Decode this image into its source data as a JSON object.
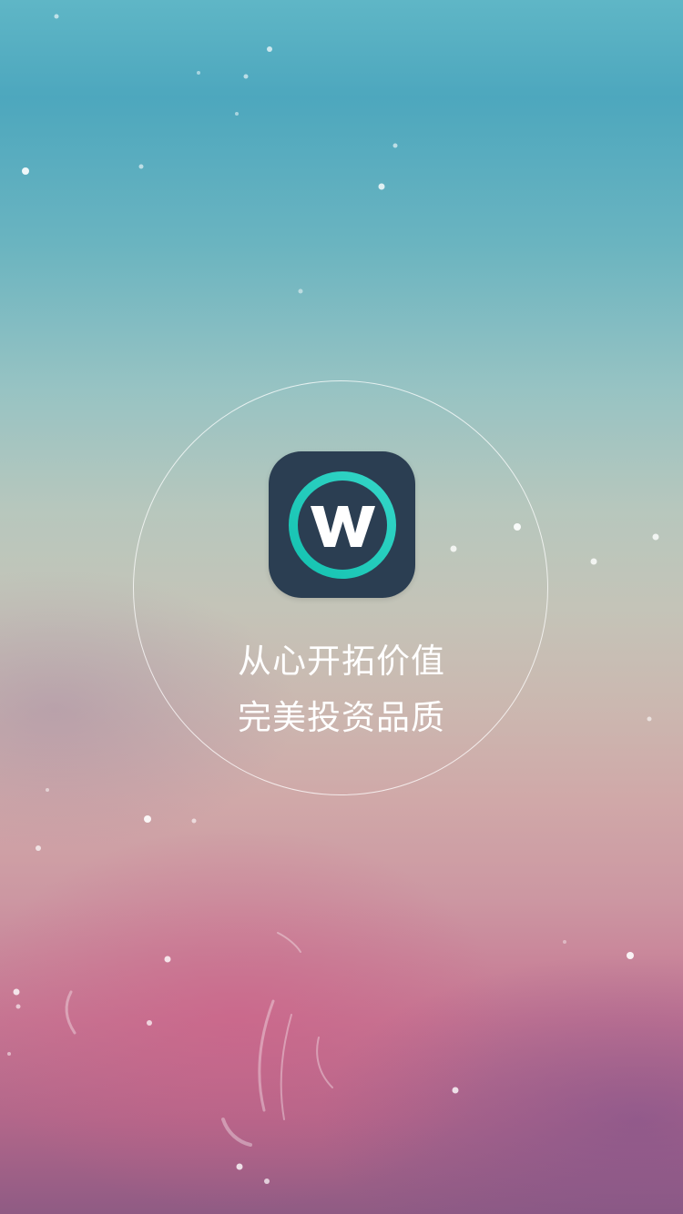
{
  "splash": {
    "tagline_line1": "从心开拓价值",
    "tagline_line2": "完美投资品质",
    "logo_icon": "w-circle-logo-icon",
    "colors": {
      "icon_bg": "#2b3e52",
      "ring_gradient_start": "#17c9b6",
      "ring_gradient_end": "#2fd0c5",
      "text": "#ffffff"
    }
  }
}
